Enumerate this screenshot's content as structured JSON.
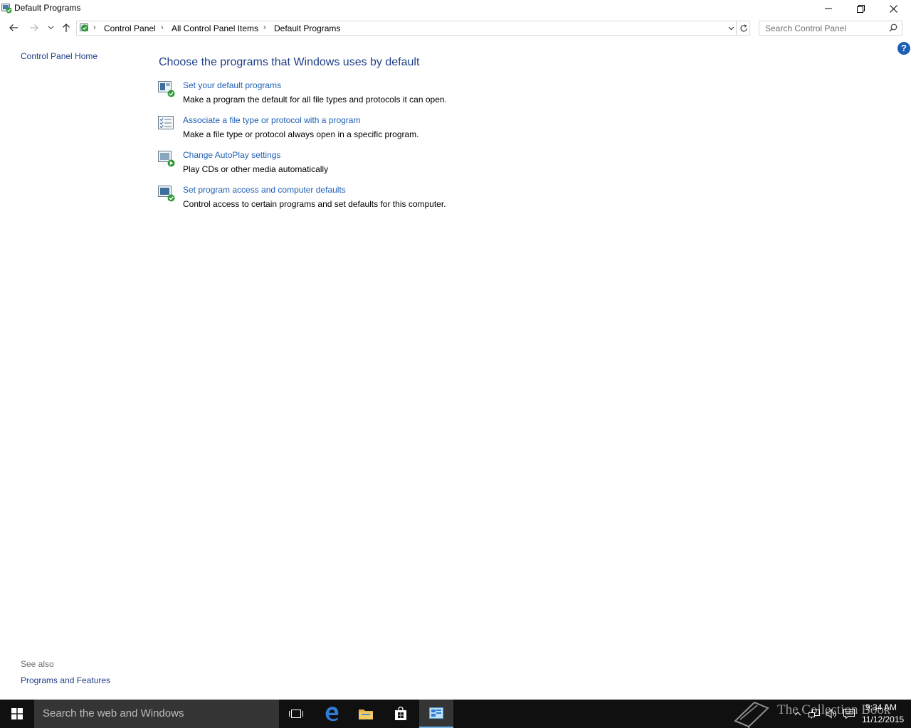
{
  "window": {
    "title": "Default Programs"
  },
  "navigation": {
    "breadcrumbs": [
      "Control Panel",
      "All Control Panel Items",
      "Default Programs"
    ],
    "search_placeholder": "Search Control Panel"
  },
  "left_pane": {
    "home_link": "Control Panel Home",
    "see_also_label": "See also",
    "see_also_links": [
      "Programs and Features"
    ]
  },
  "main": {
    "heading": "Choose the programs that Windows uses by default",
    "tasks": [
      {
        "icon": "default-programs-check-icon",
        "link": "Set your default programs",
        "description": "Make a program the default for all file types and protocols it can open."
      },
      {
        "icon": "file-association-list-icon",
        "link": "Associate a file type or protocol with a program",
        "description": "Make a file type or protocol always open in a specific program."
      },
      {
        "icon": "autoplay-icon",
        "link": "Change AutoPlay settings",
        "description": "Play CDs or other media automatically"
      },
      {
        "icon": "program-access-icon",
        "link": "Set program access and computer defaults",
        "description": "Control access to certain programs and set defaults for this computer."
      }
    ]
  },
  "taskbar": {
    "search_text": "Search the web and Windows",
    "watermark": "The Collection Book",
    "time": "9:34 AM",
    "date": "11/12/2015"
  },
  "colors": {
    "link": "#1e5fb4",
    "heading": "#1e3f87",
    "taskbar": "#101010",
    "taskbar_search": "#353535"
  }
}
